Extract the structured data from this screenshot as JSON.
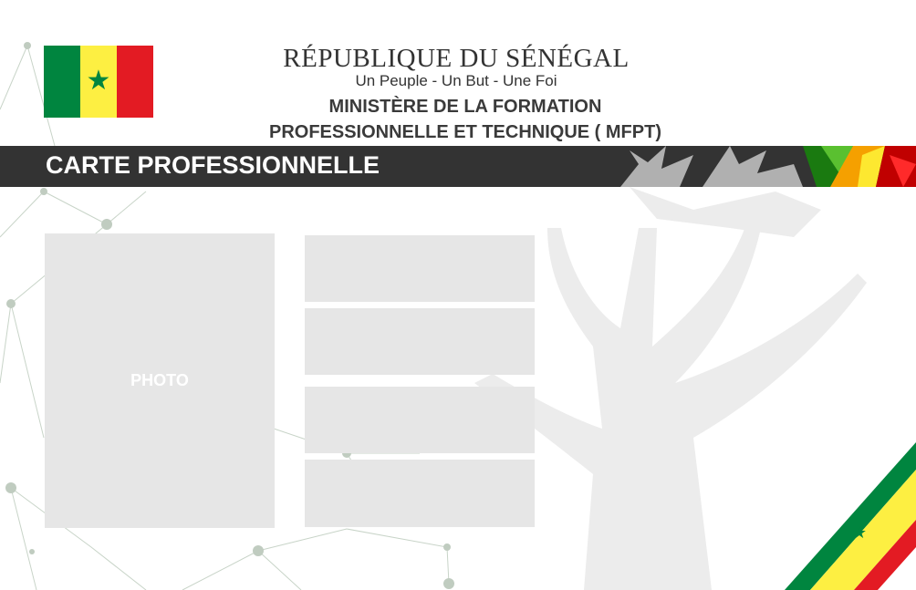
{
  "header": {
    "country": "RÉPUBLIQUE DU SÉNÉGAL",
    "motto": "Un Peuple - Un But - Une Foi",
    "ministry_line1": "MINISTÈRE DE LA FORMATION",
    "ministry_line2": "PROFESSIONNELLE ET TECHNIQUE ( MFPT)"
  },
  "banner": {
    "title": "CARTE PROFESSIONNELLE"
  },
  "card": {
    "photo_label": "PHOTO"
  },
  "colors": {
    "green": "#00853f",
    "yellow": "#fdef42",
    "red": "#e31b23",
    "band": "#333333",
    "placeholder": "#e6e6e6"
  }
}
